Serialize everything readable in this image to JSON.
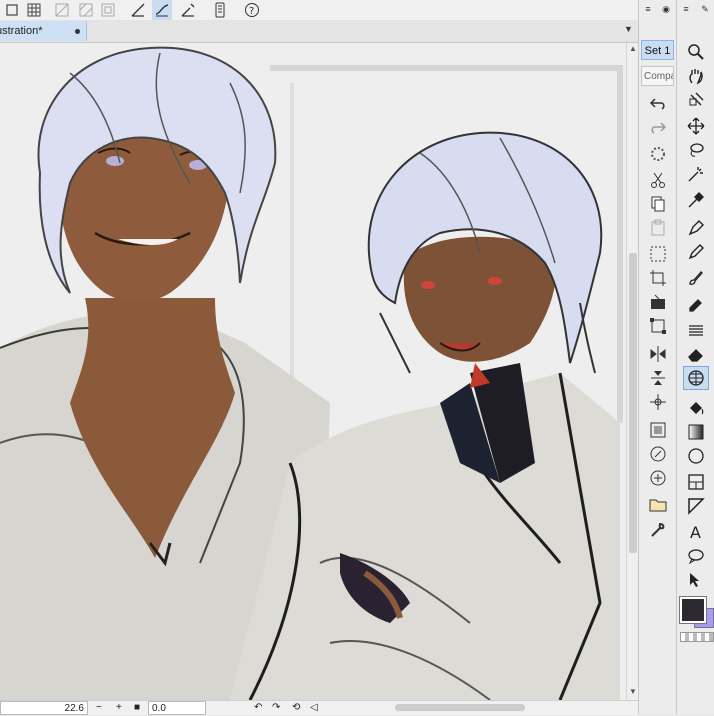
{
  "document": {
    "tab_title": "ustration*"
  },
  "toolbar": {
    "buttons": [
      "selection-tool-icon",
      "grid-icon",
      "ruler-a-icon",
      "ruler-b-icon",
      "transparency-icon",
      "pen-line-icon",
      "stabilizer-icon",
      "ruler-snap-icon",
      "device-icon",
      "help-icon"
    ]
  },
  "status": {
    "zoom": "22.6",
    "angle": "0.0"
  },
  "command_panel": {
    "set_label": "Set 1",
    "comp_label": "Compa",
    "icons": [
      "undo-icon",
      "redo-icon",
      "loading-icon",
      "cut-icon",
      "copy-icon",
      "paste-icon",
      "select-all-icon",
      "crop-icon",
      "fill-selection-icon",
      "transform-icon",
      "flip-icon",
      "align-icon",
      "move-icon",
      "reference-layer-icon",
      "brush-sync-icon",
      "sync-icon",
      "open-folder-icon",
      "settings-wrench-icon"
    ]
  },
  "tool_panel": {
    "tools": [
      "zoom-icon",
      "hand-icon",
      "rotate-icon",
      "move-icon",
      "lasso-icon",
      "magic-wand-icon",
      "eyedropper-icon",
      "pen-icon",
      "pencil-icon",
      "brush-icon",
      "marker-icon",
      "blend-icon",
      "eraser-icon",
      "active-mesh-icon",
      "fill-bucket-icon",
      "gradient-icon",
      "ellipse-icon",
      "frame-icon",
      "ruler-icon",
      "text-icon",
      "balloon-icon",
      "pointer-icon"
    ],
    "active_tool": "active-mesh-icon",
    "main_color": "#2b2830",
    "sub_color": "#a99af5"
  },
  "colors": {
    "accent": "#c9dcf2",
    "canvas": "#f0f0f0"
  }
}
